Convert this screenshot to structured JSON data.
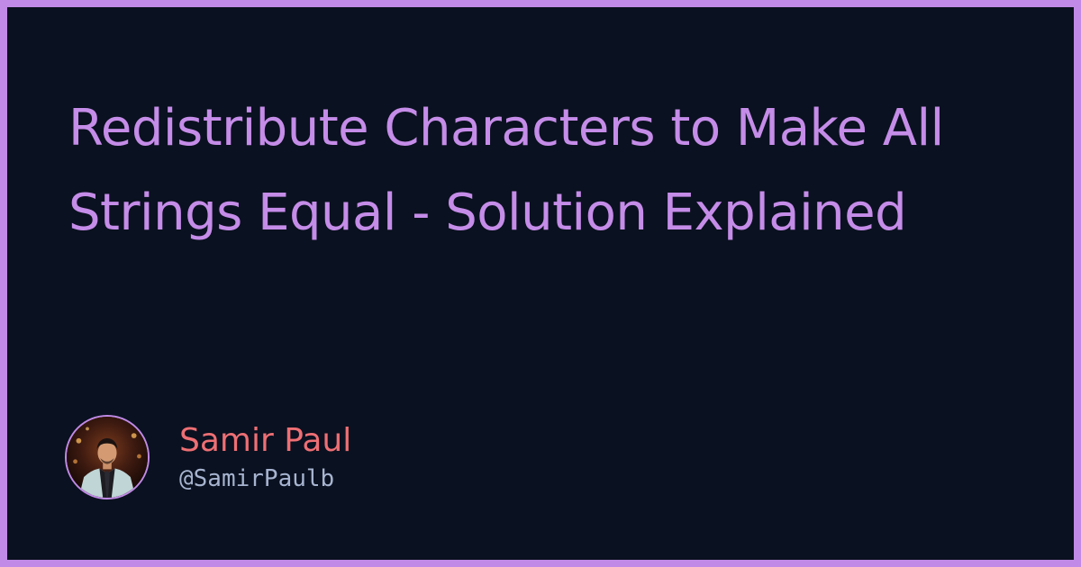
{
  "post": {
    "title": "Redistribute Characters to Make All Strings Equal - Solution Explained"
  },
  "author": {
    "name": "Samir Paul",
    "handle": "@SamirPaulb",
    "avatar_icon": "avatar-photo"
  },
  "colors": {
    "frame": "#c08ae6",
    "background": "#0a1120",
    "title": "#c58ce8",
    "author_name": "#ee6f74",
    "author_handle": "#a7b4d0"
  }
}
